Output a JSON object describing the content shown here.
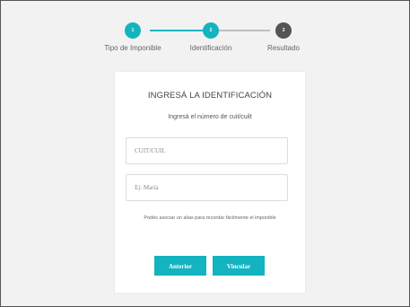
{
  "stepper": {
    "steps": [
      {
        "number": "1",
        "label": "Tipo de Imponible",
        "state": "done"
      },
      {
        "number": "2",
        "label": "Identificación",
        "state": "done"
      },
      {
        "number": "3",
        "label": "Resultado",
        "state": "todo"
      }
    ]
  },
  "card": {
    "title": "INGRESÁ LA IDENTIFICACIÓN",
    "subtitle": "Ingresá el número de cuit/cuilt",
    "cuit_placeholder": "CUIT/CUIL",
    "alias_placeholder": "Ej: María",
    "hint": "Podés asociar un alias para recordar fácilmente el imponible",
    "prev_label": "Anterior",
    "next_label": "Vincular"
  },
  "colors": {
    "accent": "#13b3c0",
    "inactive_step": "#555555",
    "background": "#f2f2f2"
  }
}
